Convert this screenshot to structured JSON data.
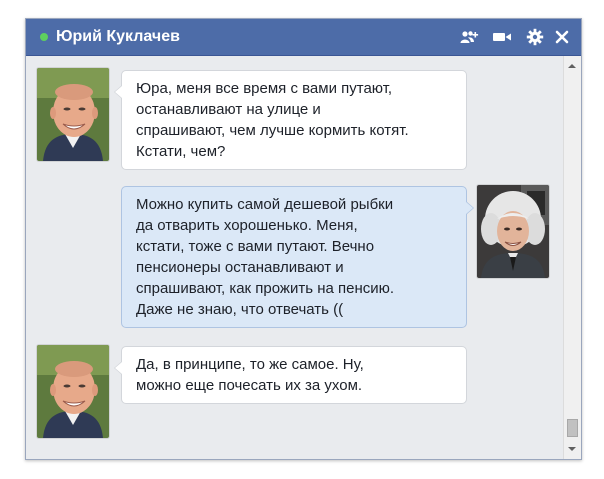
{
  "chat": {
    "contact_name": "Юрий Куклачев",
    "online": true,
    "colors": {
      "titlebar": "#4d6ca8",
      "online_dot": "#5ed05e",
      "incoming_bubble": "#ffffff",
      "outgoing_bubble": "#dbe8f7",
      "background": "#e9ebee"
    },
    "toolbar_icons": [
      "add-friend-icon",
      "video-call-icon",
      "gear-icon",
      "close-icon"
    ]
  },
  "messages": [
    {
      "direction": "incoming",
      "text": "Юра, меня все время с вами путают,\nостанавливают на улице и\nспрашивают, чем лучше кормить котят.\nКстати, чем?"
    },
    {
      "direction": "outgoing",
      "text": "Можно купить самой дешевой рыбки\nда отварить хорошенько. Меня,\nкстати, тоже с вами путают. Вечно\nпенсионеры останавливают и\nспрашивают, как прожить на пенсию.\nДаже не знаю, что отвечать (("
    },
    {
      "direction": "incoming",
      "text": "Да, в принципе, то же самое. Ну,\nможно еще почесать их за ухом."
    }
  ],
  "scroll": {
    "position_fraction": 0.95
  }
}
